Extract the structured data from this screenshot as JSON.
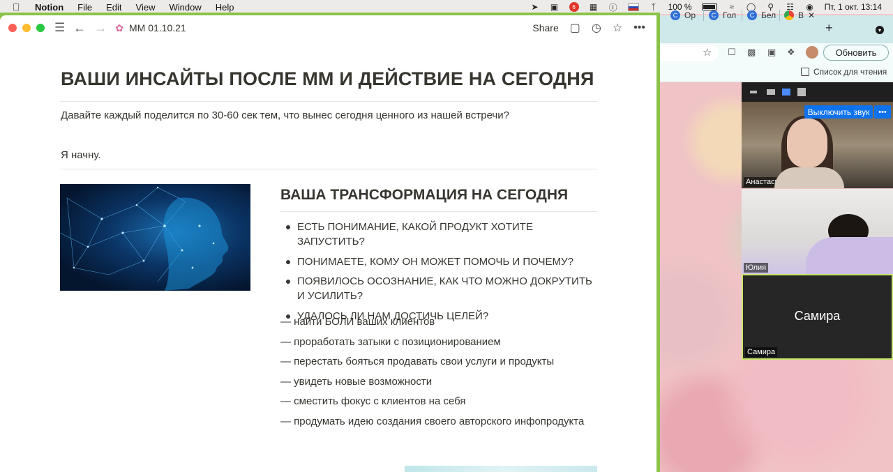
{
  "menubar": {
    "app": "Notion",
    "items": [
      "File",
      "Edit",
      "View",
      "Window",
      "Help"
    ],
    "notification_count": "6",
    "battery": "100 %",
    "datetime": "Пт, 1 окт.  13:14"
  },
  "notion": {
    "page_title": "MM 01.10.21",
    "share_label": "Share",
    "heading1": "ВАШИ ИНСАЙТЫ ПОСЛЕ ММ И ДЕЙСТВИЕ НА СЕГОДНЯ",
    "paragraph1": "Давайте каждый поделится по 30-60 сек тем, что вынес сегодня ценного из нашей встречи?",
    "paragraph2": "Я начну.",
    "heading2": "ВАША ТРАНСФОРМАЦИЯ НА СЕГОДНЯ",
    "bullets": [
      "ЕСТЬ ПОНИМАНИЕ, КАКОЙ ПРОДУКТ ХОТИТЕ ЗАПУСТИТЬ?",
      "ПОНИМАЕТЕ, КОМУ ОН МОЖЕТ ПОМОЧЬ И ПОЧЕМУ?",
      "ПОЯВИЛОСЬ ОСОЗНАНИЕ, КАК ЧТО МОЖНО ДОКРУТИТЬ И УСИЛИТЬ?",
      "УДАЛОСЬ ЛИ НАМ ДОСТИЧЬ ЦЕЛЕЙ?"
    ],
    "dash_items": [
      "— найти БОЛИ ваших клиентов",
      "— проработать затыки с позиционированием",
      "— перестать бояться продавать свои услуги и продукты",
      "— увидеть новые возможности",
      "— сместить фокус с клиентов на себя",
      "— продумать идею создания своего авторского инфопродукта"
    ]
  },
  "chrome": {
    "tabs": [
      "Ор",
      "Гол",
      "Бел",
      "В"
    ],
    "update_label": "Обновить",
    "reading_list": "Список для чтения"
  },
  "zoom": {
    "unmute_label": "Выключить звук",
    "more_label": "•••",
    "participants": [
      "Анастасия Вовк",
      "Юлия",
      "Самира"
    ],
    "active_name": "Самира"
  },
  "colors": {
    "accent_green": "#8bc34a",
    "zoom_blue": "#0e72ed",
    "active_speaker": "#c7e56b"
  }
}
